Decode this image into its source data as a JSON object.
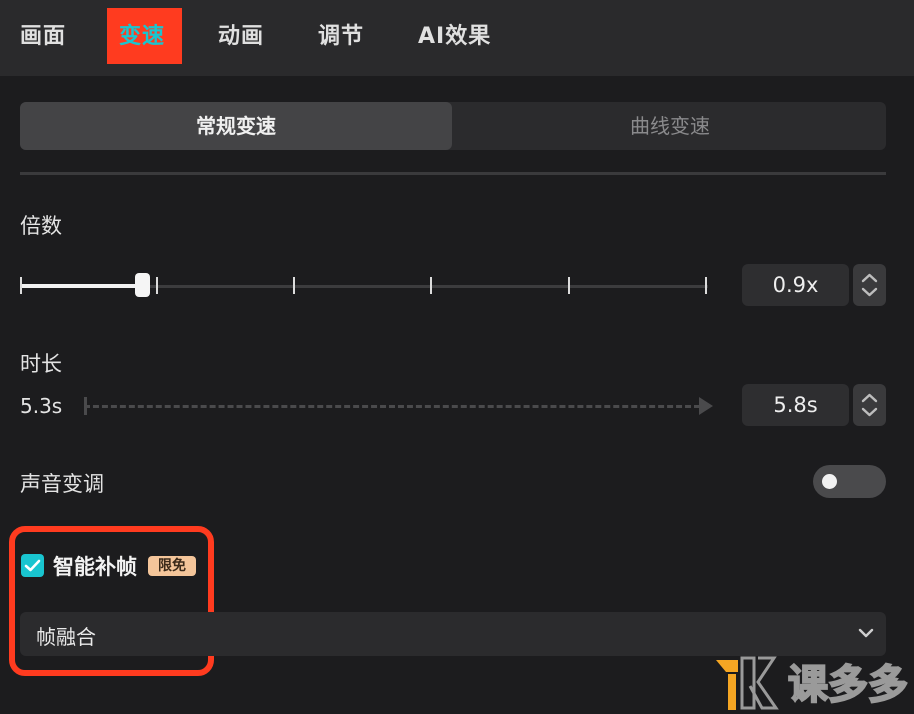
{
  "tabs": [
    {
      "label": "画面"
    },
    {
      "label": "变速"
    },
    {
      "label": "动画"
    },
    {
      "label": "调节"
    },
    {
      "label": "AI效果"
    }
  ],
  "active_tab": "变速",
  "speed_modes": {
    "normal": "常规变速",
    "curve": "曲线变速"
  },
  "multiplier": {
    "label": "倍数",
    "value": "0.9x",
    "slider_fraction": 0.18
  },
  "duration": {
    "label": "时长",
    "original": "5.3s",
    "value": "5.8s"
  },
  "pitch": {
    "label": "声音变调",
    "enabled": false
  },
  "smart_frame": {
    "label": "智能补帧",
    "badge": "限免",
    "checked": true,
    "option": "帧融合"
  },
  "watermark": {
    "text": "课多多"
  },
  "colors": {
    "accent": "#19c5d0",
    "highlight": "#ff3b1f",
    "badge_bg": "#f4c59a",
    "logo_orange": "#f5a623"
  }
}
